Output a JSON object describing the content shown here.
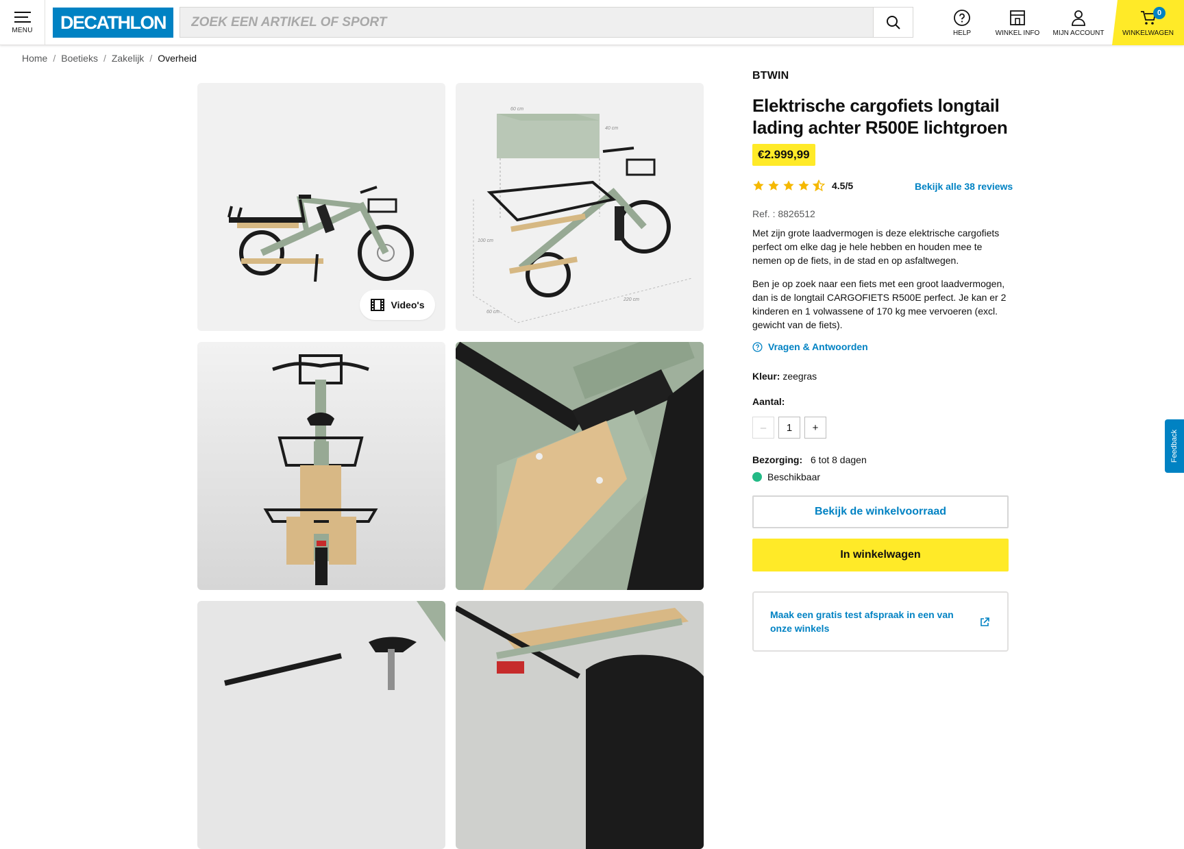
{
  "header": {
    "menu_label": "MENU",
    "logo_text": "DECATHLON",
    "search_placeholder": "ZOEK EEN ARTIKEL OF SPORT",
    "links": {
      "help": "HELP",
      "shop_info": "WINKEL INFO",
      "account": "MIJN ACCOUNT",
      "cart": "WINKELWAGEN"
    },
    "cart_count": "0"
  },
  "breadcrumb": [
    "Home",
    "Boetieks",
    "Zakelijk",
    "Overheid"
  ],
  "gallery": {
    "video_label": "Video's",
    "dimension_labels": [
      "60 cm",
      "40 cm",
      "100 cm",
      "60 cm",
      "220 cm"
    ]
  },
  "product": {
    "brand": "BTWIN",
    "title": "Elektrische cargofiets longtail lading achter R500E lichtgroen",
    "price": "€2.999,99",
    "rating_score": 4.5,
    "rating_text": "4.5/5",
    "reviews_link": "Bekijk alle 38 reviews",
    "ref": "Ref. : 8826512",
    "description_1": "Met zijn grote laadvermogen is deze elektrische cargofiets perfect om elke dag je hele hebben en houden mee te nemen op de fiets, in de stad en op asfaltwegen.",
    "description_2": "Ben je op zoek naar een fiets met een groot laadvermogen, dan is de longtail CARGOFIETS R500E perfect. Je kan er 2 kinderen en 1 volwassene of 170 kg mee vervoeren (excl. gewicht van de fiets).",
    "qa_link": "Vragen & Antwoorden",
    "color_label": "Kleur:",
    "color_value": "zeegras",
    "quantity_label": "Aantal:",
    "quantity_value": "1",
    "delivery_label": "Bezorging:",
    "delivery_value": "6 tot 8 dagen",
    "availability": "Beschikbaar",
    "stock_button": "Bekijk de winkelvoorraad",
    "cart_button": "In winkelwagen",
    "test_appointment": "Maak een gratis test afspraak in een van onze winkels"
  },
  "feedback_label": "Feedback",
  "colors": {
    "brand_blue": "#0082c3",
    "accent_yellow": "#ffea28",
    "star": "#f5b800",
    "available_green": "#23ba86"
  }
}
